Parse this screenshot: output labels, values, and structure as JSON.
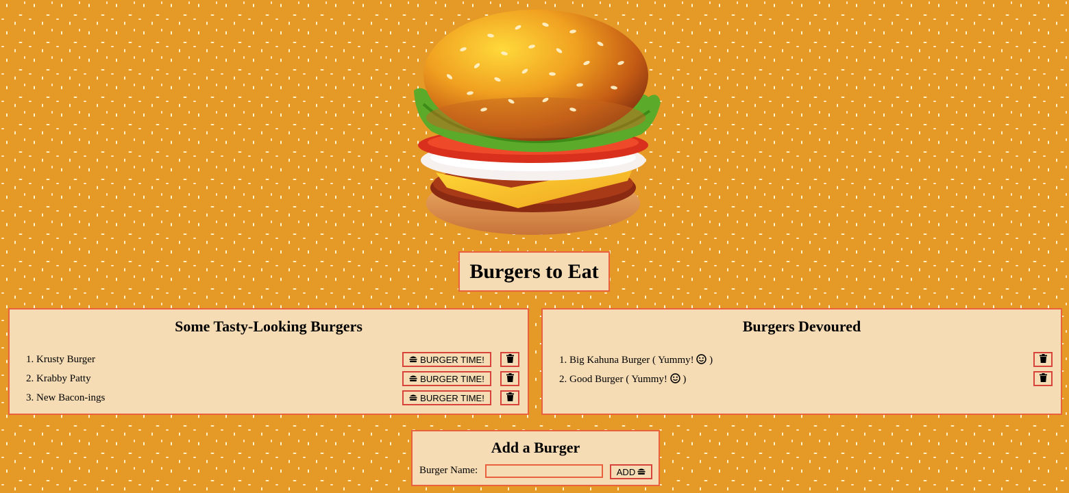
{
  "page": {
    "title": "Burgers to Eat",
    "accent_color": "#e8603d",
    "panel_color": "#f5dcb4",
    "background_color": "#e59a27"
  },
  "hero": {
    "icon": "hamburger-illustration"
  },
  "to_eat": {
    "heading": "Some Tasty-Looking Burgers",
    "eat_button_label": "BURGER TIME!",
    "eat_button_icon": "hamburger-icon",
    "delete_icon": "trash-icon",
    "items": [
      {
        "number": "1.",
        "name": "Krusty Burger"
      },
      {
        "number": "2.",
        "name": "Krabby Patty"
      },
      {
        "number": "3.",
        "name": "New Bacon-ings"
      }
    ]
  },
  "devoured": {
    "heading": "Burgers Devoured",
    "suffix_open": "( Yummy!",
    "suffix_close": ")",
    "suffix_icon": "smile-icon",
    "delete_icon": "trash-icon",
    "items": [
      {
        "number": "1.",
        "name": "Big Kahuna Burger"
      },
      {
        "number": "2.",
        "name": "Good Burger"
      }
    ]
  },
  "add_form": {
    "heading": "Add a Burger",
    "label": "Burger Name:",
    "input_value": "",
    "button_label": "ADD",
    "button_icon": "hamburger-icon"
  }
}
